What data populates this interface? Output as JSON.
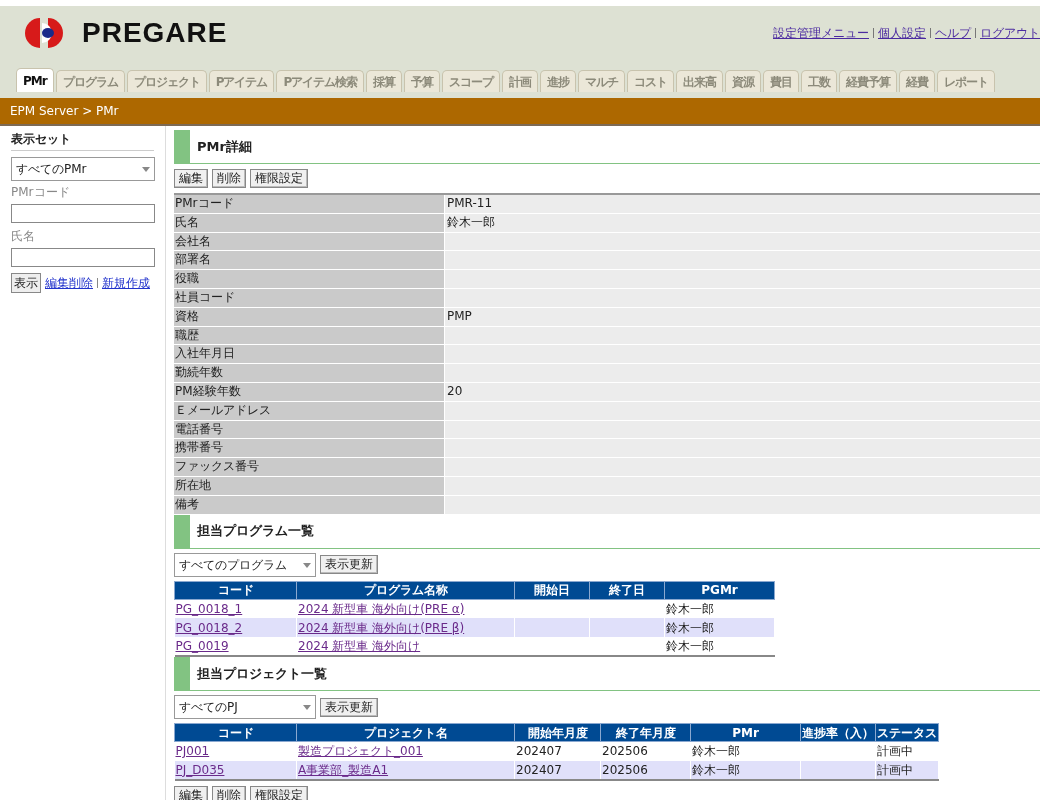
{
  "header": {
    "logo": "PREGARE",
    "links": [
      "設定管理メニュー",
      "個人設定",
      "ヘルプ",
      "ログアウト"
    ]
  },
  "tabs": [
    {
      "label": "PMr",
      "selected": true
    },
    {
      "label": "プログラム",
      "selected": false
    },
    {
      "label": "プロジェクト",
      "selected": false
    },
    {
      "label": "Pアイテム",
      "selected": false
    },
    {
      "label": "Pアイテム検索",
      "selected": false
    },
    {
      "label": "採算",
      "selected": false
    },
    {
      "label": "予算",
      "selected": false
    },
    {
      "label": "スコープ",
      "selected": false
    },
    {
      "label": "計画",
      "selected": false
    },
    {
      "label": "進捗",
      "selected": false
    },
    {
      "label": "マルチ",
      "selected": false
    },
    {
      "label": "コスト",
      "selected": false
    },
    {
      "label": "出来高",
      "selected": false
    },
    {
      "label": "資源",
      "selected": false
    },
    {
      "label": "費目",
      "selected": false
    },
    {
      "label": "工数",
      "selected": false
    },
    {
      "label": "経費予算",
      "selected": false
    },
    {
      "label": "経費",
      "selected": false
    },
    {
      "label": "レポート",
      "selected": false
    }
  ],
  "breadcrumb": "EPM Server > PMr",
  "sidebar": {
    "title": "表示セット",
    "select": "すべてのPMr",
    "fields": [
      {
        "label": "PMrコード"
      },
      {
        "label": "氏名"
      }
    ],
    "button": "表示",
    "links": [
      "編集削除",
      "新規作成"
    ]
  },
  "detail": {
    "title": "PMr詳細",
    "buttons": [
      "編集",
      "削除",
      "権限設定"
    ],
    "rows": [
      {
        "label": "PMrコード",
        "value": "PMR-11"
      },
      {
        "label": "氏名",
        "value": "鈴木一郎"
      },
      {
        "label": "会社名"
      },
      {
        "label": "部署名"
      },
      {
        "label": "役職"
      },
      {
        "label": "社員コード"
      },
      {
        "label": "資格",
        "value": "PMP"
      },
      {
        "label": "職歴"
      },
      {
        "label": "入社年月日"
      },
      {
        "label": "勤続年数"
      },
      {
        "label": "PM経験年数",
        "value": "20"
      },
      {
        "label": "Ｅメールアドレス"
      },
      {
        "label": "電話番号"
      },
      {
        "label": "携帯番号"
      },
      {
        "label": "ファックス番号"
      },
      {
        "label": "所在地"
      },
      {
        "label": "備考"
      }
    ]
  },
  "programs": {
    "title": "担当プログラム一覧",
    "select": "すべてのプログラム",
    "button": "表示更新",
    "columns": [
      "コード",
      "プログラム名称",
      "開始日",
      "終了日",
      "PGMr"
    ],
    "rows": [
      [
        "PG_0018_1",
        "2024 新型車 海外向け(PRE α)",
        "",
        "",
        "鈴木一郎"
      ],
      [
        "PG_0018_2",
        "2024 新型車 海外向け(PRE β)",
        "",
        "",
        "鈴木一郎"
      ],
      [
        "PG_0019",
        "2024 新型車 海外向け",
        "",
        "",
        "鈴木一郎"
      ]
    ]
  },
  "projects": {
    "title": "担当プロジェクト一覧",
    "select": "すべてのPJ",
    "button": "表示更新",
    "columns": [
      "コード",
      "プロジェクト名",
      "開始年月度",
      "終了年月度",
      "PMr",
      "進捗率（入）",
      "ステータス"
    ],
    "rows": [
      [
        "PJ001",
        "製造プロジェクト_001",
        "202407",
        "202506",
        "鈴木一郎",
        "",
        "計画中"
      ],
      [
        "PJ_D035",
        "A事業部_製造A1",
        "202407",
        "202506",
        "鈴木一郎",
        "",
        "計画中"
      ]
    ]
  },
  "footer_buttons": [
    "編集",
    "削除",
    "権限設定"
  ]
}
